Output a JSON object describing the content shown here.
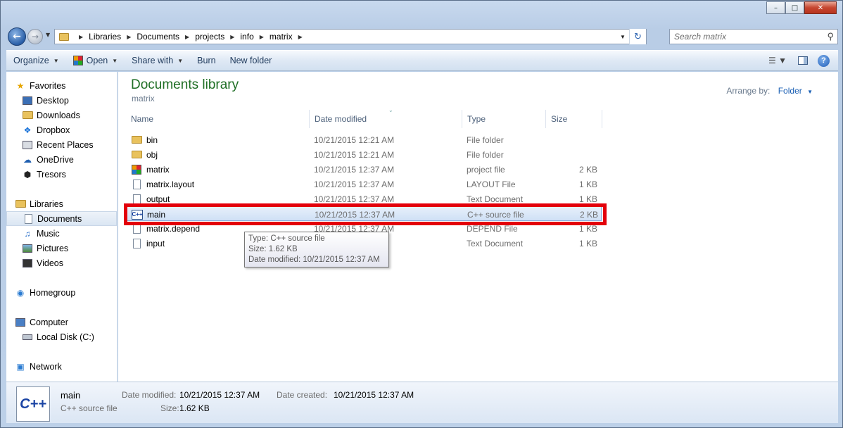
{
  "window": {
    "caption_min": "–",
    "caption_max": "□",
    "caption_close": "✕"
  },
  "address": {
    "crumbs": [
      "Libraries",
      "Documents",
      "projects",
      "info",
      "matrix"
    ],
    "search_placeholder": "Search matrix"
  },
  "commands": {
    "organize": "Organize",
    "open": "Open",
    "share_with": "Share with",
    "burn": "Burn",
    "new_folder": "New folder"
  },
  "nav": {
    "favorites": "Favorites",
    "desktop": "Desktop",
    "downloads": "Downloads",
    "dropbox": "Dropbox",
    "recent_places": "Recent Places",
    "onedrive": "OneDrive",
    "tresors": "Tresors",
    "libraries": "Libraries",
    "documents": "Documents",
    "music": "Music",
    "pictures": "Pictures",
    "videos": "Videos",
    "homegroup": "Homegroup",
    "computer": "Computer",
    "local_disk": "Local Disk (C:)",
    "network": "Network"
  },
  "library": {
    "title": "Documents library",
    "subtitle": "matrix",
    "arrange_label": "Arrange by:",
    "arrange_value": "Folder"
  },
  "columns": {
    "name": "Name",
    "date": "Date modified",
    "type": "Type",
    "size": "Size"
  },
  "files": [
    {
      "name": "bin",
      "date": "10/21/2015 12:21 AM",
      "type": "File folder",
      "size": ""
    },
    {
      "name": "obj",
      "date": "10/21/2015 12:21 AM",
      "type": "File folder",
      "size": ""
    },
    {
      "name": "matrix",
      "date": "10/21/2015 12:37 AM",
      "type": "project file",
      "size": "2 KB"
    },
    {
      "name": "matrix.layout",
      "date": "10/21/2015 12:37 AM",
      "type": "LAYOUT File",
      "size": "1 KB"
    },
    {
      "name": "output",
      "date": "10/21/2015 12:37 AM",
      "type": "Text Document",
      "size": "1 KB"
    },
    {
      "name": "main",
      "date": "10/21/2015 12:37 AM",
      "type": "C++ source file",
      "size": "2 KB"
    },
    {
      "name": "matrix.depend",
      "date": "10/21/2015 12:37 AM",
      "type": "DEPEND File",
      "size": "1 KB"
    },
    {
      "name": "input",
      "date": "",
      "type": "Text Document",
      "size": "1 KB"
    }
  ],
  "tooltip": {
    "line1": "Type: C++ source file",
    "line2": "Size: 1.62 KB",
    "line3": "Date modified: 10/21/2015 12:37 AM"
  },
  "details": {
    "icon_text": "C++",
    "name": "main",
    "type": "C++ source file",
    "date_modified_label": "Date modified:",
    "date_modified": "10/21/2015 12:37 AM",
    "date_created_label": "Date created:",
    "date_created": "10/21/2015 12:37 AM",
    "size_label": "Size:",
    "size": "1.62 KB"
  }
}
